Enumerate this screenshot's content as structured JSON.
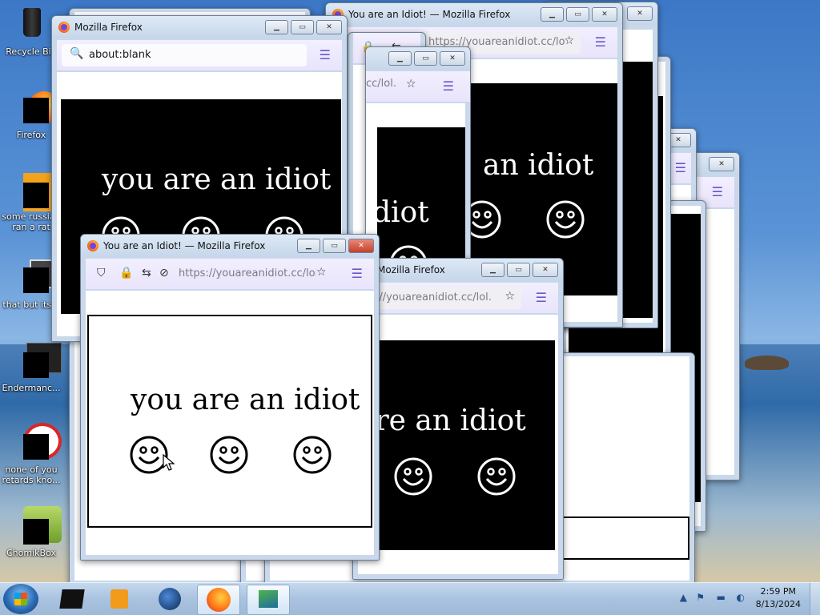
{
  "desktop": {
    "icons": [
      {
        "label": "Recycle Bin"
      },
      {
        "label": "Firefox"
      },
      {
        "label": "some russian ran a rat"
      },
      {
        "label": "that but its..."
      },
      {
        "label": "Endermanc..."
      },
      {
        "label": "none of you retards kno..."
      },
      {
        "label": "ChomikBox"
      }
    ]
  },
  "windows": {
    "blank_title": "Mozilla Firefox",
    "blank_url": "about:blank",
    "idiot_title": "You are an Idiot! — Mozilla Firefox",
    "idiot_url": "https://youareanidiot.cc/lol.",
    "partial_title": "Mozilla Firefox",
    "partial_url": "https://youareanidiot.cc/lol.",
    "partial_url_short": "://youareanidiot.cc/lol.",
    "partial_url_tail": "cc/lol.",
    "page_text": "you are an idiot",
    "page_text_partial": "an idiot",
    "page_text_diot": "diot",
    "page_text_are": "are an idiot"
  },
  "taskbar": {
    "clock_time": "2:59 PM",
    "clock_date": "8/13/2024"
  },
  "colors": {
    "firefox_accent": "#6b56c8",
    "close_red": "#c4402b",
    "taskbar": "#a8c2df"
  }
}
